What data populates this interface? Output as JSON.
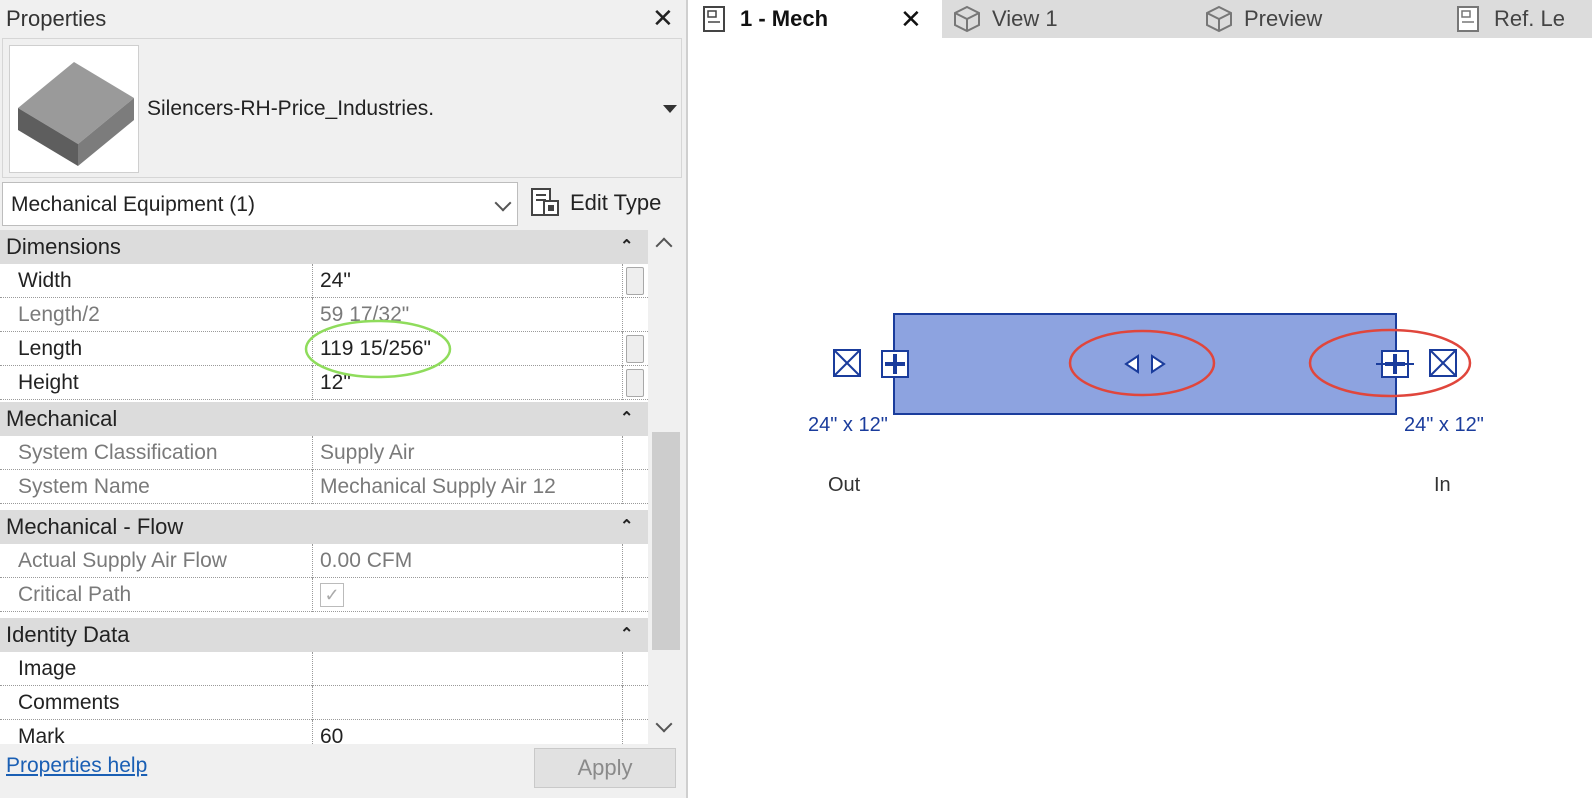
{
  "properties": {
    "title": "Properties",
    "close": "✕",
    "type_name": "Silencers-RH-Price_Industries.",
    "category": "Mechanical Equipment (1)",
    "edit_type": "Edit Type",
    "help": "Properties help",
    "apply": "Apply",
    "groups": {
      "dimensions": "Dimensions",
      "mechanical": "Mechanical",
      "flow": "Mechanical - Flow",
      "identity": "Identity Data"
    },
    "rows": {
      "width": {
        "name": "Width",
        "value": "24\""
      },
      "length_half": {
        "name": "Length/2",
        "value": "59 17/32\""
      },
      "length": {
        "name": "Length",
        "value": "119 15/256\""
      },
      "height": {
        "name": "Height",
        "value": "12\""
      },
      "system_classification": {
        "name": "System Classification",
        "value": "Supply Air"
      },
      "system_name": {
        "name": "System Name",
        "value": "Mechanical Supply Air 12"
      },
      "actual_flow": {
        "name": "Actual Supply Air Flow",
        "value": "0.00 CFM"
      },
      "critical_path": {
        "name": "Critical Path",
        "checked": true
      },
      "image": {
        "name": "Image",
        "value": ""
      },
      "comments": {
        "name": "Comments",
        "value": ""
      },
      "mark": {
        "name": "Mark",
        "value": "60"
      }
    }
  },
  "tabs": [
    {
      "label": "1 - Mech",
      "active": true
    },
    {
      "label": "View 1"
    },
    {
      "label": "Preview"
    },
    {
      "label": "Ref. Le"
    }
  ],
  "tab_close": "✕",
  "canvas": {
    "left_size": "24\" x 12\"",
    "right_size": "24\" x 12\"",
    "left_label": "Out",
    "right_label": "In"
  },
  "colors": {
    "equipment_fill": "#8da3e0",
    "equipment_stroke": "#1a3c9c",
    "highlight_green": "#8fdc5c",
    "highlight_red": "#e0463c"
  },
  "icons": {
    "view_tab": "sheet-view-icon",
    "3d_tab": "cube-3d-icon",
    "edit_type": "edit-type-icon"
  }
}
